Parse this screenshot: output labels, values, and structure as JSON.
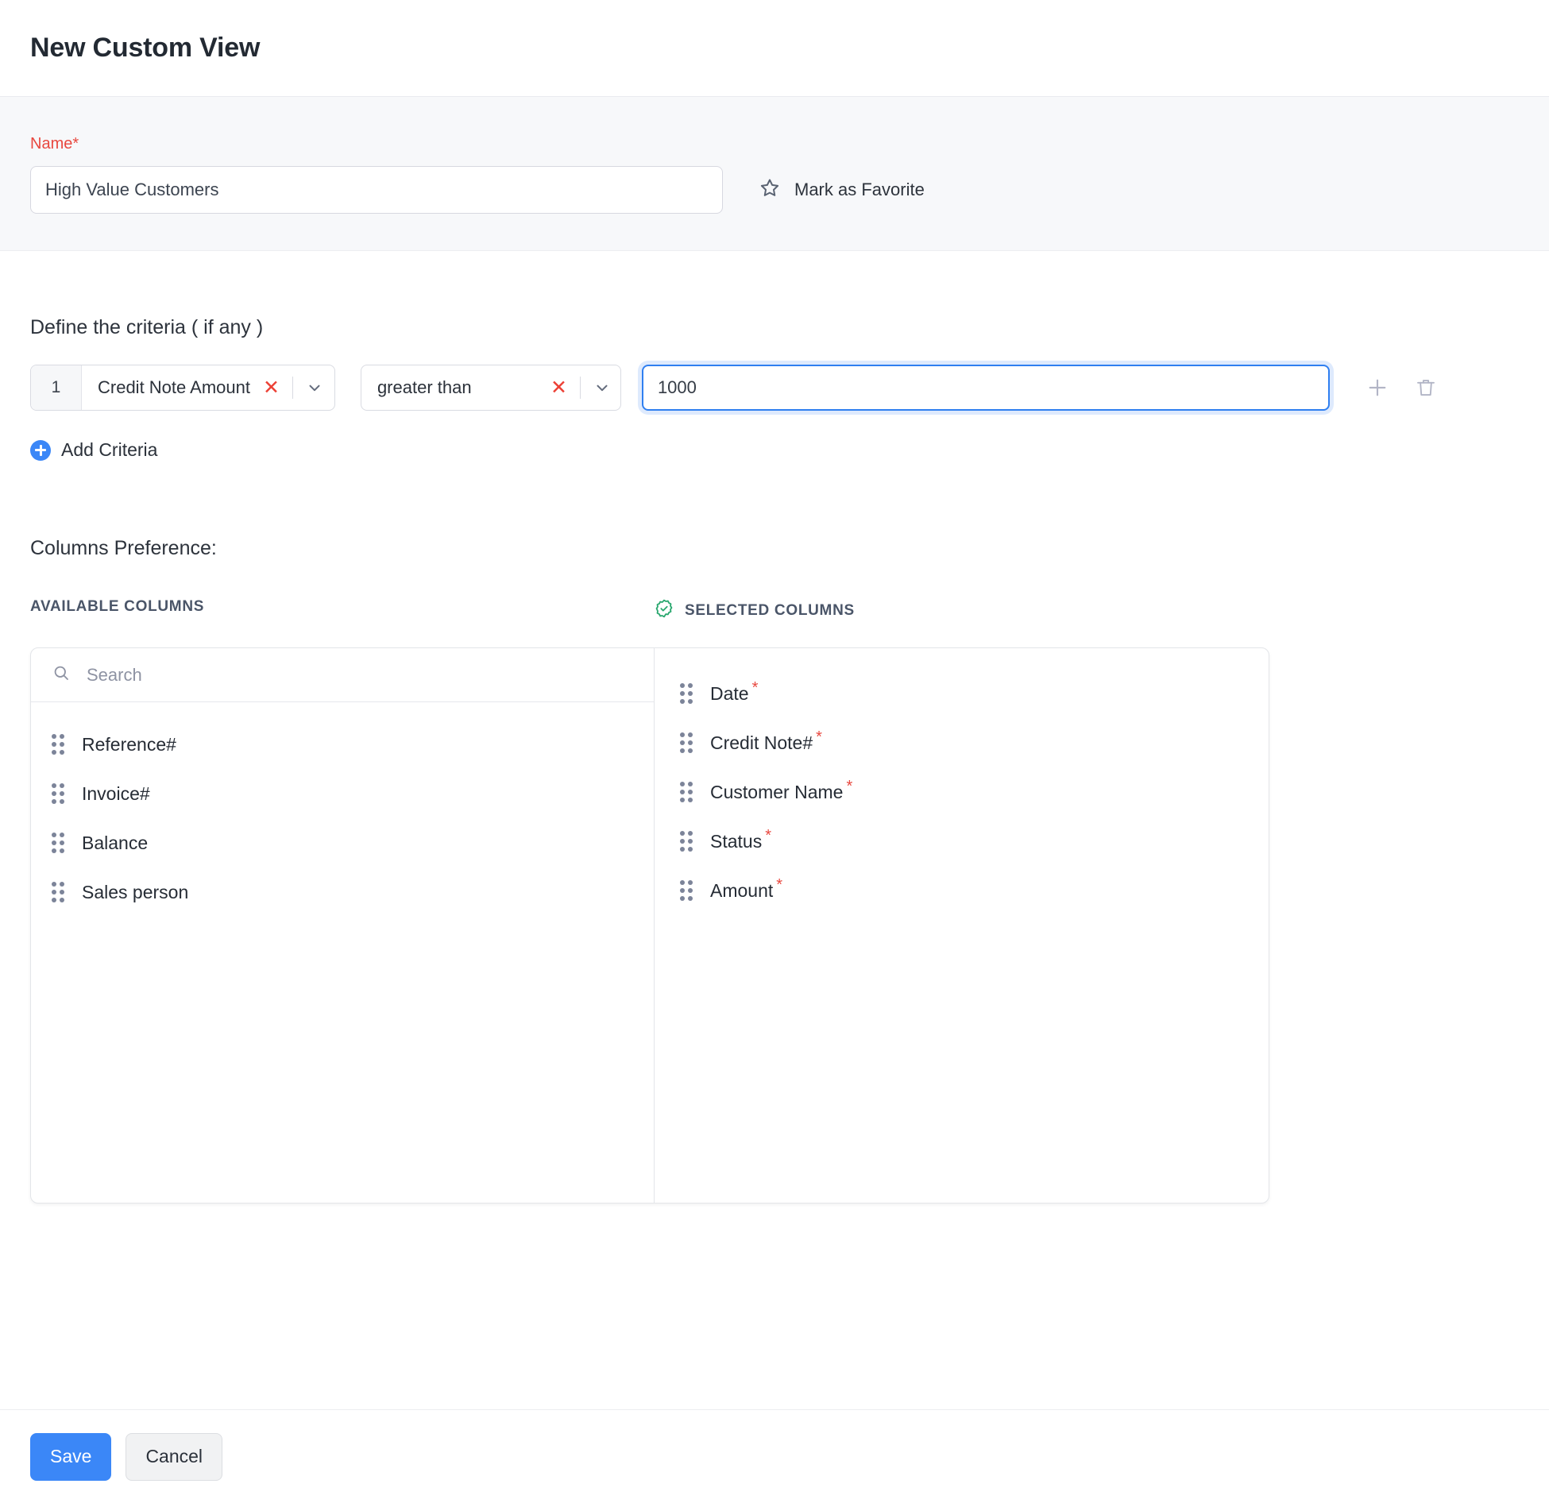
{
  "header": {
    "title": "New Custom View"
  },
  "name_section": {
    "label": "Name*",
    "value": "High Value Customers",
    "placeholder": "",
    "favorite_label": "Mark as Favorite",
    "favorite_icon": "star-outline-icon"
  },
  "criteria": {
    "heading": "Define the criteria ( if any )",
    "rows": [
      {
        "index": "1",
        "field": "Credit Note Amount",
        "operator": "greater than",
        "value": "1000",
        "clear_icon": "close-x-icon",
        "chevron_icon": "chevron-down-icon"
      }
    ],
    "add_row_icon": "plus-icon",
    "delete_row_icon": "trash-icon",
    "add_criteria_label": "Add Criteria",
    "add_criteria_icon": "plus-circle-icon"
  },
  "columns_preference": {
    "heading": "Columns Preference:",
    "available": {
      "title": "AVAILABLE COLUMNS",
      "search_placeholder": "Search",
      "search_value": "",
      "search_icon": "search-icon",
      "items": [
        {
          "label": "Reference#",
          "required": false
        },
        {
          "label": "Invoice#",
          "required": false
        },
        {
          "label": "Balance",
          "required": false
        },
        {
          "label": "Sales person",
          "required": false
        }
      ]
    },
    "selected": {
      "title": "SELECTED COLUMNS",
      "title_icon": "badge-check-icon",
      "items": [
        {
          "label": "Date",
          "required": true
        },
        {
          "label": "Credit Note#",
          "required": true
        },
        {
          "label": "Customer Name",
          "required": true
        },
        {
          "label": "Status",
          "required": true
        },
        {
          "label": "Amount",
          "required": true
        }
      ]
    },
    "drag_handle_icon": "drag-handle-icon",
    "required_marker": "*"
  },
  "footer": {
    "save_label": "Save",
    "cancel_label": "Cancel"
  },
  "colors": {
    "accent_blue": "#3b87f7",
    "required_red": "#e8483f",
    "selected_green": "#2aa86f",
    "focus_blue": "#2f7ff0"
  }
}
